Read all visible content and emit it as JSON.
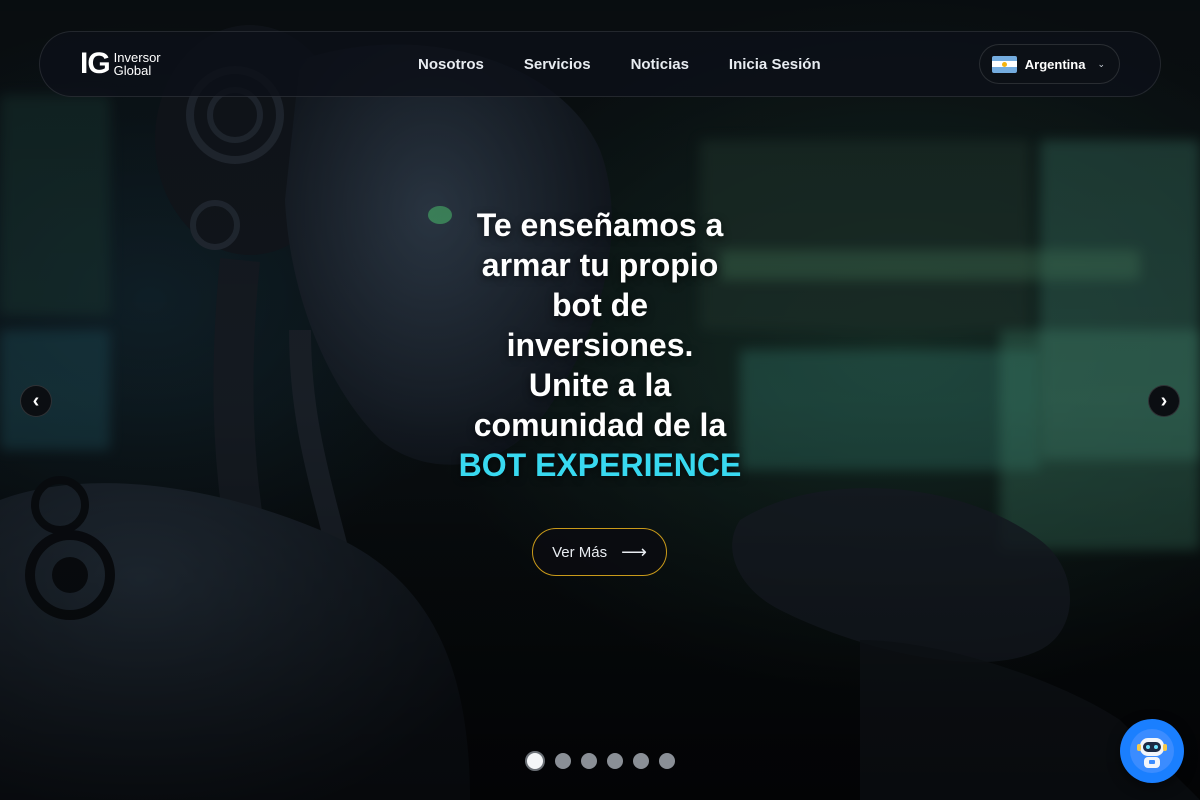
{
  "brand": {
    "mark": "IG",
    "line1": "Inversor",
    "line2": "Global"
  },
  "nav": {
    "items": [
      "Nosotros",
      "Servicios",
      "Noticias",
      "Inicia Sesión"
    ]
  },
  "country": {
    "name": "Argentina",
    "flag": "argentina-flag"
  },
  "hero": {
    "headline_lines": [
      "Te enseñamos a",
      "armar tu propio",
      "bot de",
      "inversiones.",
      "Unite a la",
      "comunidad de la"
    ],
    "headline_accent": "BOT EXPERIENCE",
    "cta_label": "Ver Más",
    "accent_color": "#38d9f0"
  },
  "carousel": {
    "prev_icon": "chevron-left-icon",
    "next_icon": "chevron-right-icon",
    "slide_count": 6,
    "active_slide": 1
  },
  "chat": {
    "icon": "robot-assistant-icon"
  }
}
